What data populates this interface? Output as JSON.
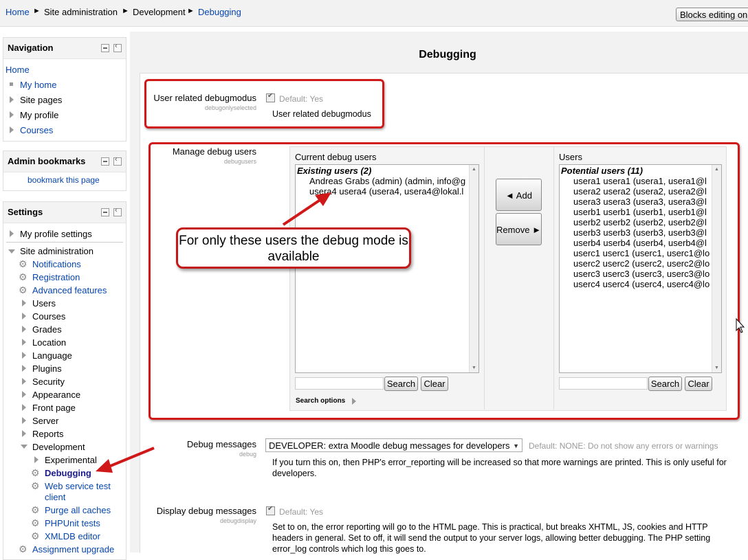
{
  "breadcrumb": {
    "home": "Home",
    "site_admin": "Site administration",
    "development": "Development",
    "debugging": "Debugging",
    "separator": "►"
  },
  "blocks_button": "Blocks editing on",
  "navigation": {
    "title": "Navigation",
    "home": "Home",
    "items": [
      "My home",
      "Site pages",
      "My profile",
      "Courses"
    ]
  },
  "admin_bookmarks": {
    "title": "Admin bookmarks",
    "link": "bookmark this page"
  },
  "settings": {
    "title": "Settings",
    "my_profile_settings": "My profile settings",
    "site_administration": "Site administration",
    "items": [
      "Notifications",
      "Registration",
      "Advanced features",
      "Users",
      "Courses",
      "Grades",
      "Location",
      "Language",
      "Plugins",
      "Security",
      "Appearance",
      "Front page",
      "Server",
      "Reports",
      "Development"
    ],
    "development_items": [
      "Experimental",
      "Debugging",
      "Web service test client",
      "Purge all caches",
      "PHPUnit tests",
      "XMLDB editor"
    ],
    "last_item": "Assignment upgrade"
  },
  "page": {
    "title": "Debugging"
  },
  "setting_user_debug": {
    "label": "User related debugmodus",
    "name": "debugonlyselected",
    "default": "Default: Yes",
    "description": "User related debugmodus"
  },
  "setting_debug_users": {
    "label": "Manage debug users",
    "name": "debugusers",
    "current_title": "Current debug users",
    "existing_group": "Existing users (2)",
    "existing": [
      "Andreas Grabs (admin) (admin, info@g",
      "usera4 usera4 (usera4, usera4@lokal.l"
    ],
    "users_title": "Users",
    "potential_group": "Potential users (11)",
    "potential": [
      "usera1 usera1 (usera1, usera1@l",
      "usera2 usera2 (usera2, usera2@l",
      "usera3 usera3 (usera3, usera3@l",
      "userb1 userb1 (userb1, userb1@l",
      "userb2 userb2 (userb2, userb2@l",
      "userb3 userb3 (userb3, userb3@l",
      "userb4 userb4 (userb4, userb4@l",
      "userc1 userc1 (userc1, userc1@lo",
      "userc2 userc2 (userc2, userc2@lo",
      "userc3 userc3 (userc3, userc3@lo",
      "userc4 userc4 (userc4, userc4@lo"
    ],
    "add": "◄ Add",
    "remove": "Remove ►",
    "search": "Search",
    "clear": "Clear",
    "search_options": "Search options"
  },
  "callout": "For only these users the debug mode is available",
  "setting_debug_messages": {
    "label": "Debug messages",
    "name": "debug",
    "selected": "DEVELOPER: extra Moodle debug messages for developers",
    "default": "Default: NONE: Do not show any errors or warnings",
    "description": "If you turn this on, then PHP's error_reporting will be increased so that more warnings are printed. This is only useful for developers."
  },
  "setting_display_debug": {
    "label": "Display debug messages",
    "name": "debugdisplay",
    "default": "Default: Yes",
    "description": "Set to on, the error reporting will go to the HTML page. This is practical, but breaks XHTML, JS, cookies and HTTP headers in general. Set to off, it will send the output to your server logs, allowing better debugging. The PHP setting error_log controls which log this goes to."
  },
  "colors": {
    "link": "#0645ad",
    "annotation_red": "#d01818",
    "panel_bg": "#f2f2f2"
  }
}
